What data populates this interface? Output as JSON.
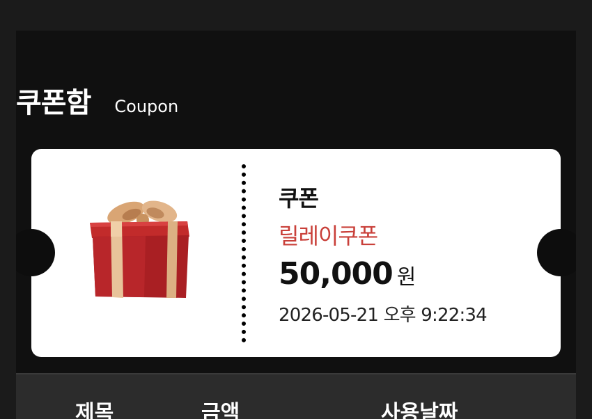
{
  "header": {
    "title_ko": "쿠폰함",
    "title_en": "Coupon"
  },
  "coupon": {
    "label": "쿠폰",
    "name": "릴레이쿠폰",
    "amount": "50,000",
    "unit": "원",
    "datetime": "2026-05-21 오후 9:22:34",
    "image_icon": "gift-box-icon",
    "name_color": "#c9403a"
  },
  "table": {
    "columns": [
      "제목",
      "금액",
      "사용날짜"
    ]
  }
}
